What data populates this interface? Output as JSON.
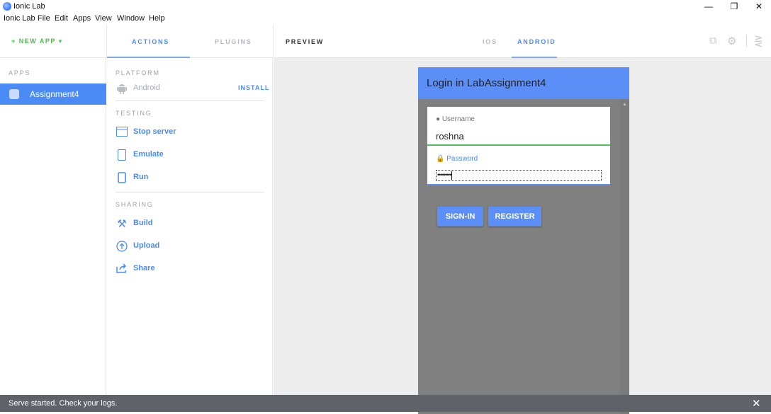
{
  "window": {
    "title": "Ionic Lab",
    "controls": {
      "minimize": "—",
      "restore": "❐",
      "close": "✕"
    }
  },
  "menu": [
    "Ionic Lab",
    "File",
    "Edit",
    "Apps",
    "View",
    "Window",
    "Help"
  ],
  "header": {
    "new_app": "+ NEW APP ▾",
    "tabs": {
      "actions": "ACTIONS",
      "plugins": "PLUGINS",
      "preview": "PREVIEW",
      "ios": "IOS",
      "android": "ANDROID"
    },
    "icons": [
      "open-external-icon",
      "settings-icon",
      "collapse-panel-icon"
    ]
  },
  "apps": {
    "section": "APPS",
    "items": [
      {
        "name": "Assignment4",
        "selected": true
      }
    ]
  },
  "actions": {
    "platform": {
      "section": "PLATFORM",
      "name": "Android",
      "install": "INSTALL"
    },
    "testing": {
      "section": "TESTING",
      "items": [
        {
          "label": "Stop server",
          "icon": "browser-window-icon"
        },
        {
          "label": "Emulate",
          "icon": "tablet-icon"
        },
        {
          "label": "Run",
          "icon": "phone-icon"
        }
      ]
    },
    "sharing": {
      "section": "SHARING",
      "items": [
        {
          "label": "Build",
          "icon": "tools-icon"
        },
        {
          "label": "Upload",
          "icon": "upload-icon"
        },
        {
          "label": "Share",
          "icon": "share-icon"
        }
      ]
    }
  },
  "preview": {
    "title": "Login in LabAssignment4",
    "username_label": "Username",
    "username_value": "roshna",
    "password_label": "Password",
    "password_value": "•••••••••",
    "signin": "SIGN-IN",
    "register": "REGISTER"
  },
  "status": {
    "text": "Serve started. Check your logs.",
    "close": "✕"
  },
  "colors": {
    "accent": "#4a8bf5",
    "header_blue": "#5b8ef7",
    "green": "#4fb84f",
    "device_gray": "#808080",
    "status_bar": "#5f6268"
  }
}
